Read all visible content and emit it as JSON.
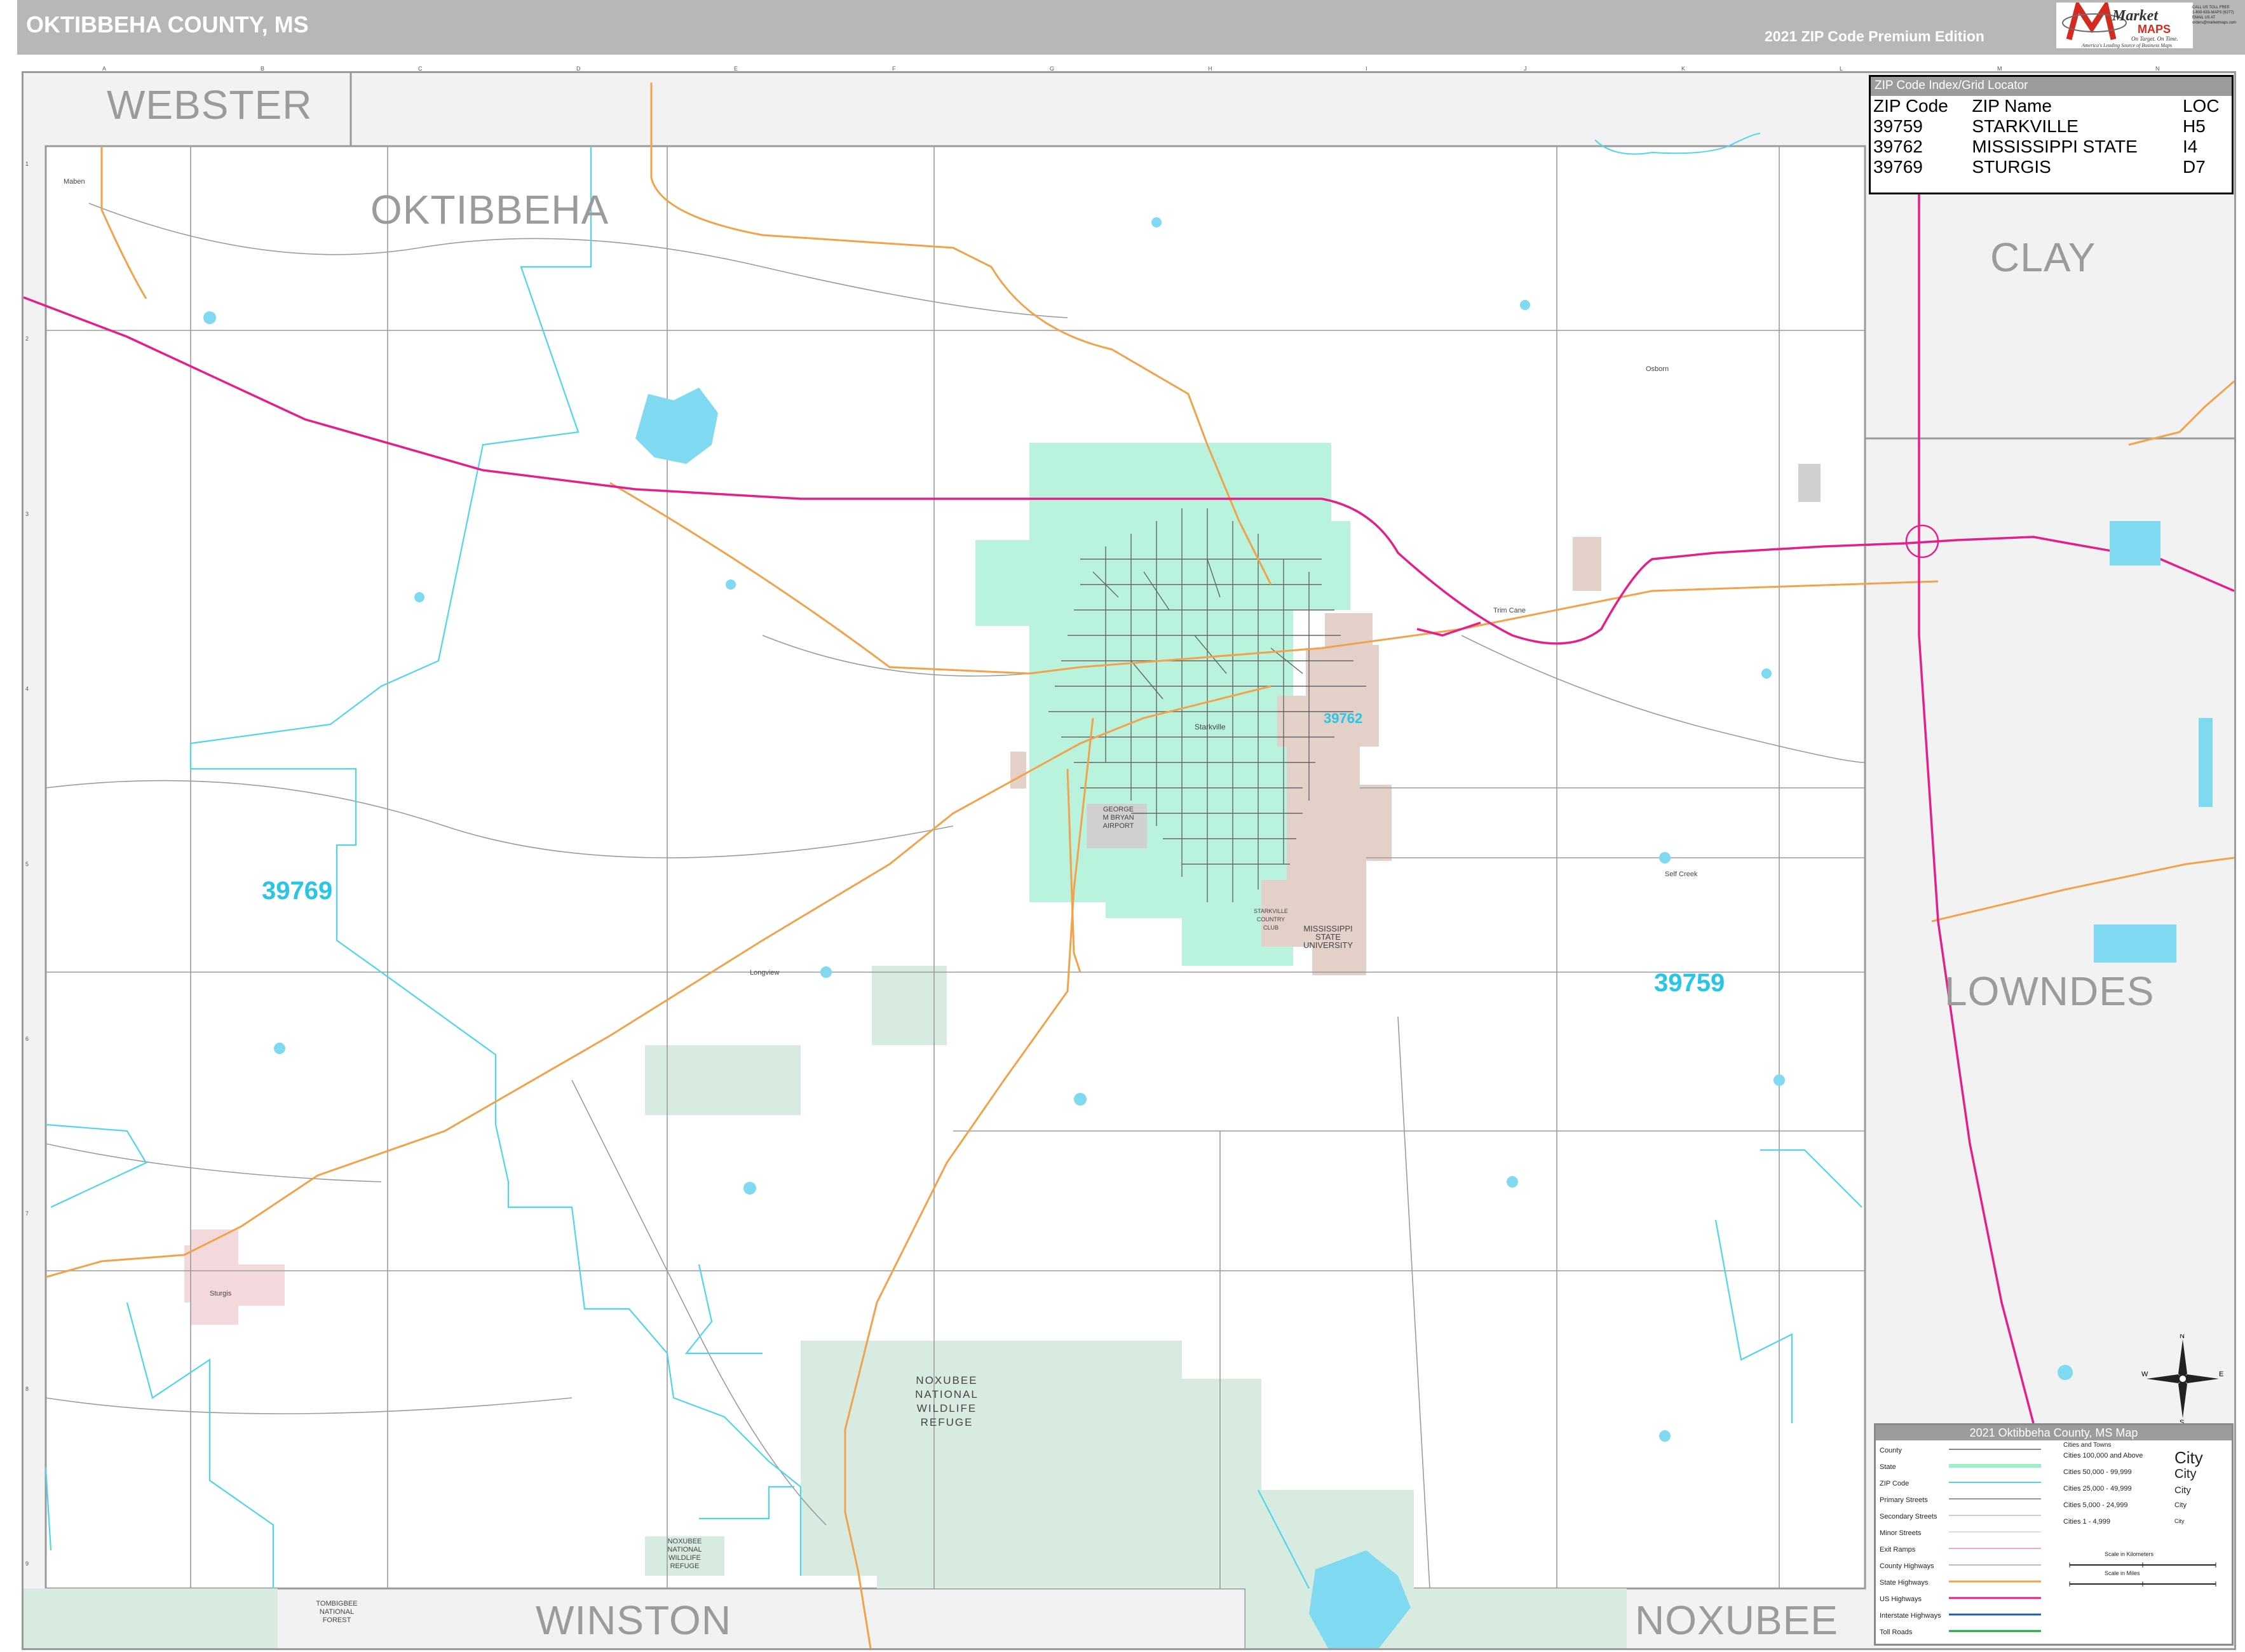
{
  "header": {
    "title": "OKTIBBEHA COUNTY, MS",
    "edition": "2021 ZIP Code Premium Edition",
    "logo_top": "Market",
    "logo_bottom": "MAPS",
    "logo_tagline": "On Target. On Time.",
    "logo_subtagline": "America's Leading Source of Business Maps",
    "contact_lines": [
      "CALL US TOLL FREE",
      "1-800-633-MAPS (6277)",
      "EMAIL US AT",
      "orders@marketmaps.com"
    ]
  },
  "colors": {
    "zip_39759": "#b9f3dd",
    "zip_39762": "#e3d0c9",
    "wildlife_refuge": "#d8ebe0",
    "county_outside": "#f2f2f2",
    "interstate": "#e61e8c",
    "state_highway": "#f2a24a",
    "water": "#7fd9f0",
    "zip_boundary": "#4ed5ee"
  },
  "counties": {
    "webster": "WEBSTER",
    "oktibbeha": "OKTIBBEHA",
    "clay": "CLAY",
    "lowndes": "LOWNDES",
    "winston": "WINSTON",
    "noxubee": "NOXUBEE"
  },
  "zip_labels": {
    "z39769": "39769",
    "z39759": "39759",
    "z39762": "39762"
  },
  "places": {
    "starkville": "Starkville",
    "msu": [
      "MISSISSIPPI",
      "STATE",
      "UNIVERSITY"
    ],
    "refuge_main": [
      "NOXUBEE",
      "NATIONAL",
      "WILDLIFE",
      "REFUGE"
    ],
    "refuge_small": [
      "NOXUBEE",
      "NATIONAL",
      "WILDLIFE",
      "REFUGE"
    ],
    "tombigbee": [
      "TOMBIGBEE",
      "NATIONAL",
      "FOREST"
    ],
    "sturgis": "Sturgis",
    "longview": "Longview",
    "maben": "Maben",
    "osborn": "Osborn",
    "self_creek": "Self Creek",
    "trim_cane": "Trim Cane",
    "airport": [
      "GEORGE",
      "M BRYAN",
      "AIRPORT"
    ],
    "country_club": [
      "STARKVILLE",
      "COUNTRY",
      "CLUB"
    ]
  },
  "index": {
    "title": "ZIP Code Index/Grid Locator",
    "columns": [
      "ZIP Code",
      "ZIP Name",
      "LOC"
    ],
    "rows": [
      [
        "39759",
        "STARKVILLE",
        "H5"
      ],
      [
        "39762",
        "MISSISSIPPI STATE",
        "I4"
      ],
      [
        "39769",
        "STURGIS",
        "D7"
      ]
    ]
  },
  "legend": {
    "title": "2021 Oktibbeha County, MS Map",
    "items": [
      "County",
      "State",
      "ZIP Code",
      "Primary Streets",
      "Secondary Streets",
      "Minor Streets",
      "Exit Ramps",
      "County Highways",
      "State Highways",
      "US Highways",
      "Interstate Highways",
      "Toll Roads"
    ],
    "cities_title": "Cities and Towns",
    "city_classes": [
      {
        "label": "Cities 100,000 and Above",
        "sample": "City"
      },
      {
        "label": "Cities 50,000 - 99,999",
        "sample": "City"
      },
      {
        "label": "Cities 25,000 - 49,999",
        "sample": "City"
      },
      {
        "label": "Cities 5,000 - 24,999",
        "sample": "City"
      },
      {
        "label": "Cities 1 - 4,999",
        "sample": "City"
      }
    ],
    "scale_km": "Scale in Kilometers",
    "scale_mi": "Scale in Miles"
  },
  "compass": {
    "n": "N",
    "s": "S",
    "e": "E",
    "w": "W"
  },
  "grid": {
    "columns": [
      "A",
      "B",
      "C",
      "D",
      "E",
      "F",
      "G",
      "H",
      "I",
      "J",
      "K",
      "L",
      "M",
      "N"
    ],
    "rows": [
      "1",
      "2",
      "3",
      "4",
      "5",
      "6",
      "7",
      "8",
      "9"
    ]
  }
}
